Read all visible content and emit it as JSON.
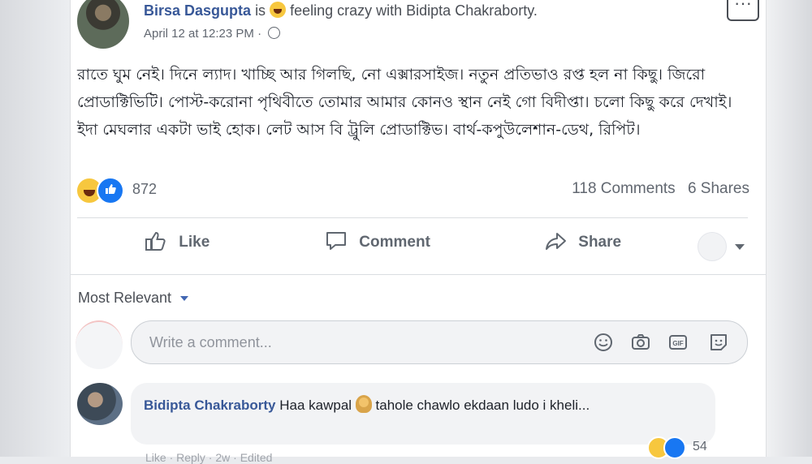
{
  "post": {
    "author": "Birsa Dasgupta",
    "is_text": "is",
    "feeling": "feeling crazy with Bidipta Chakraborty.",
    "timestamp": "April 12 at 12:23 PM",
    "separator": "·",
    "more_label": "···",
    "body": "রাতে ঘুম নেই। দিনে ল্যাদ। খাচ্ছি আর গিলছি, নো এক্সারসাইজ। নতুন প্রতিভাও রপ্ত হল না কিছু। জিরো প্রোডাক্টিভিটি। পোস্ট-করোনা পৃথিবীতে তোমার আমার কোনও স্থান নেই গো বিদীপ্তা। চলো কিছু করে দেখাই। ইদা মেঘলার একটা ভাই হোক। লেট আস বি ট্রুলি প্রোডাক্টিভ। বার্থ-কপুউলেশান-ডেথ, রিপিট।"
  },
  "reactions": {
    "count": "872",
    "comments": "118 Comments",
    "shares": "6 Shares",
    "types": [
      "haha-icon",
      "like-icon"
    ]
  },
  "actions": {
    "like": "Like",
    "comment": "Comment",
    "share": "Share"
  },
  "sort_label": "Most Relevant",
  "composer": {
    "placeholder": "Write a comment..."
  },
  "comment": {
    "author": "Bidipta Chakraborty",
    "text_before": "Haa kawpal",
    "text_after": "tahole chawlo ekdaan ludo i kheli...",
    "reaction_count": "54"
  },
  "comment_actions": "Like · Reply · 2w · Edited",
  "colors": {
    "link_blue": "#385898",
    "like_blue": "#1877f2",
    "haha_yellow": "#f7c73e",
    "text_gray": "#616770"
  }
}
